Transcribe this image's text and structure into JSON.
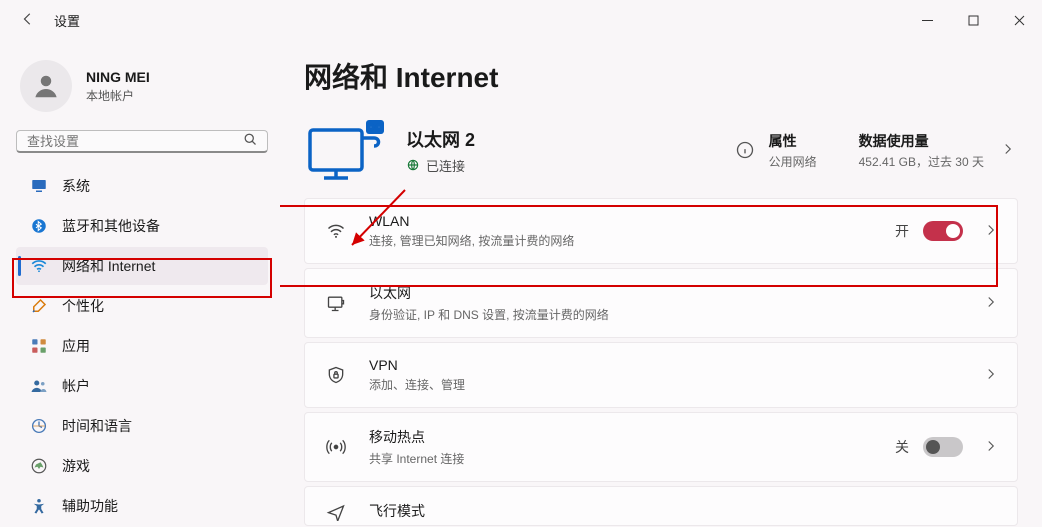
{
  "window": {
    "title": "设置"
  },
  "user": {
    "name": "NING MEI",
    "subtitle": "本地帐户"
  },
  "search": {
    "placeholder": "查找设置"
  },
  "sidebar": {
    "items": [
      {
        "label": "系统",
        "icon": "system"
      },
      {
        "label": "蓝牙和其他设备",
        "icon": "bluetooth"
      },
      {
        "label": "网络和 Internet",
        "icon": "wifi",
        "selected": true
      },
      {
        "label": "个性化",
        "icon": "personalize"
      },
      {
        "label": "应用",
        "icon": "apps"
      },
      {
        "label": "帐户",
        "icon": "accounts"
      },
      {
        "label": "时间和语言",
        "icon": "time"
      },
      {
        "label": "游戏",
        "icon": "gaming"
      },
      {
        "label": "辅助功能",
        "icon": "accessibility"
      }
    ]
  },
  "page": {
    "title": "网络和 Internet"
  },
  "status": {
    "conn_name": "以太网 2",
    "conn_state": "已连接",
    "props_label": "属性",
    "props_sub": "公用网络",
    "usage_label": "数据使用量",
    "usage_sub": "452.41 GB，过去 30 天"
  },
  "cards": {
    "wlan": {
      "title": "WLAN",
      "sub": "连接, 管理已知网络, 按流量计费的网络",
      "toggle_label": "开",
      "toggle_on": true
    },
    "ethernet": {
      "title": "以太网",
      "sub": "身份验证, IP 和 DNS 设置, 按流量计费的网络"
    },
    "vpn": {
      "title": "VPN",
      "sub": "添加、连接、管理"
    },
    "hotspot": {
      "title": "移动热点",
      "sub": "共享 Internet 连接",
      "toggle_label": "关",
      "toggle_on": false
    },
    "airplane": {
      "title": "飞行模式"
    }
  }
}
